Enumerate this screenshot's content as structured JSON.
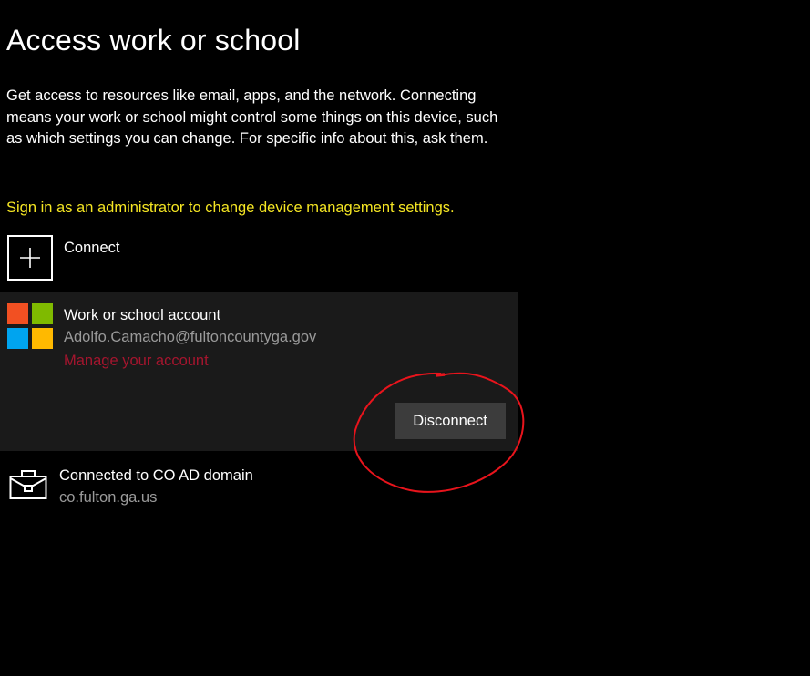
{
  "header": {
    "title": "Access work or school"
  },
  "intro": {
    "description": "Get access to resources like email, apps, and the network. Connecting means your work or school might control some things on this device, such as which settings you can change. For specific info about this, ask them."
  },
  "admin_notice": {
    "label": "Sign in as an administrator to change device management settings.",
    "color": "#f5e623"
  },
  "connect": {
    "label": "Connect",
    "icon": "plus-icon"
  },
  "account": {
    "icon": "microsoft-logo-icon",
    "title": "Work or school account",
    "email": "Adolfo.Camacho@fultoncountyga.gov",
    "manage_label": "Manage your account",
    "manage_color": "#a5152e",
    "disconnect_label": "Disconnect"
  },
  "domain": {
    "icon": "briefcase-icon",
    "title": "Connected to CO AD domain",
    "subtitle": "co.fulton.ga.us"
  },
  "annotation": {
    "shape": "hand-drawn circle",
    "color": "#e8141c"
  }
}
